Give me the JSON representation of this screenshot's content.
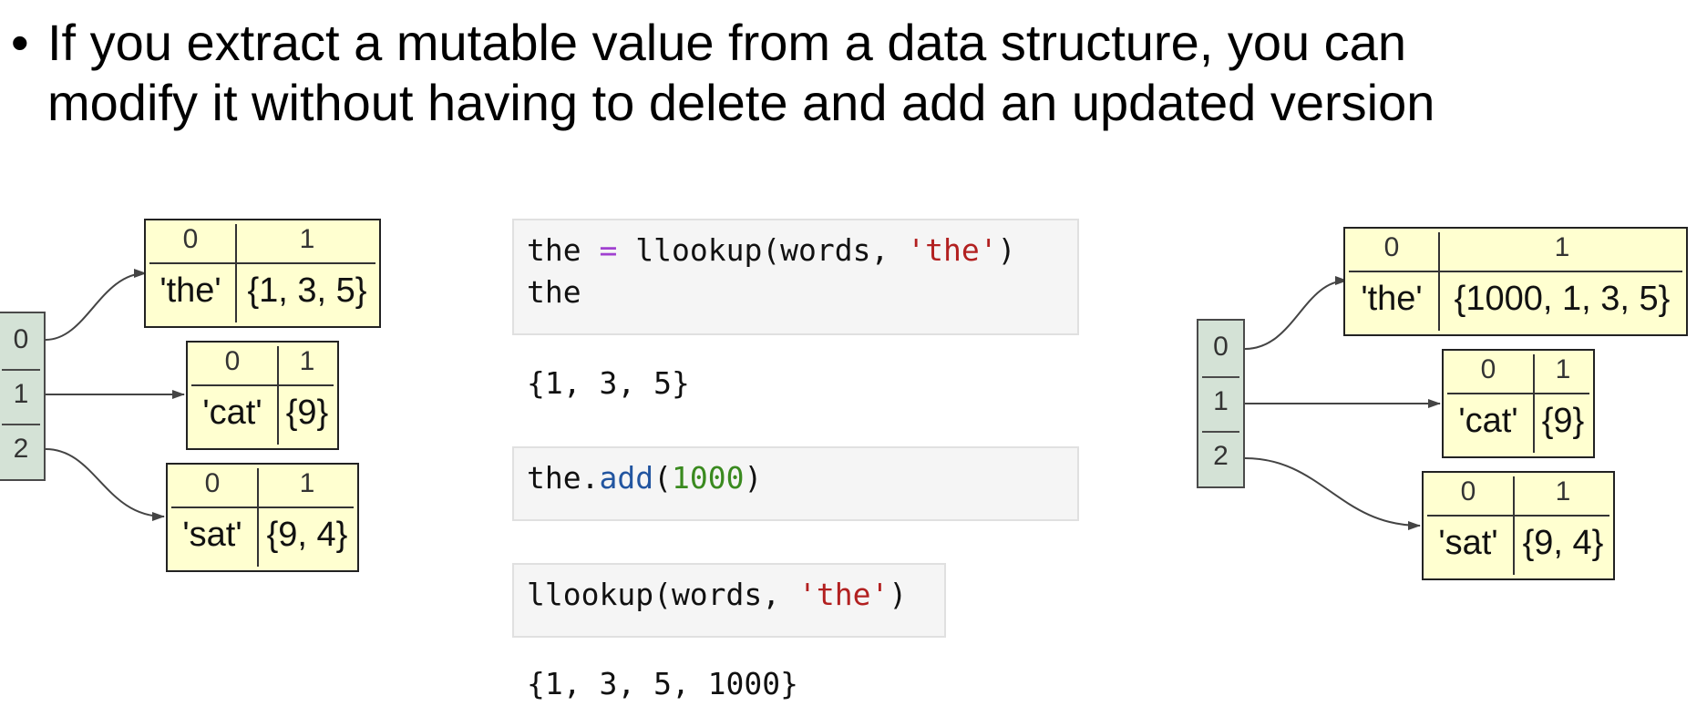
{
  "bullet": {
    "symbol": "•",
    "line1": "If you extract a mutable value from a data structure, you can",
    "line2": "modify it without having to delete and add an updated version"
  },
  "left_diagram": {
    "list_indices": [
      "0",
      "1",
      "2"
    ],
    "tuples": [
      {
        "h0": "0",
        "h1": "1",
        "key": "'the'",
        "value": "{1, 3, 5}"
      },
      {
        "h0": "0",
        "h1": "1",
        "key": "'cat'",
        "value": "{9}"
      },
      {
        "h0": "0",
        "h1": "1",
        "key": "'sat'",
        "value": "{9, 4}"
      }
    ]
  },
  "right_diagram": {
    "list_indices": [
      "0",
      "1",
      "2"
    ],
    "tuples": [
      {
        "h0": "0",
        "h1": "1",
        "key": "'the'",
        "value": "{1000, 1, 3, 5}"
      },
      {
        "h0": "0",
        "h1": "1",
        "key": "'cat'",
        "value": "{9}"
      },
      {
        "h0": "0",
        "h1": "1",
        "key": "'sat'",
        "value": "{9, 4}"
      }
    ]
  },
  "code": {
    "cell1": {
      "var": "the",
      "op": "=",
      "fn": "llookup(words, ",
      "arg": "'the'",
      "close": ")",
      "line2": "the"
    },
    "out1": "{1, 3, 5}",
    "cell2": {
      "obj": "the.",
      "method": "add",
      "open": "(",
      "num": "1000",
      "close": ")"
    },
    "cell3": {
      "fn": "llookup(words, ",
      "arg": "'the'",
      "close": ")"
    },
    "out3": "{1, 3, 5, 1000}"
  },
  "colors": {
    "tuple_fill": "#ffffd0",
    "list_fill": "#d4e2d6",
    "string": "#b22020",
    "number": "#3a8a1f",
    "method": "#2255a0",
    "operator": "#a040d0"
  }
}
